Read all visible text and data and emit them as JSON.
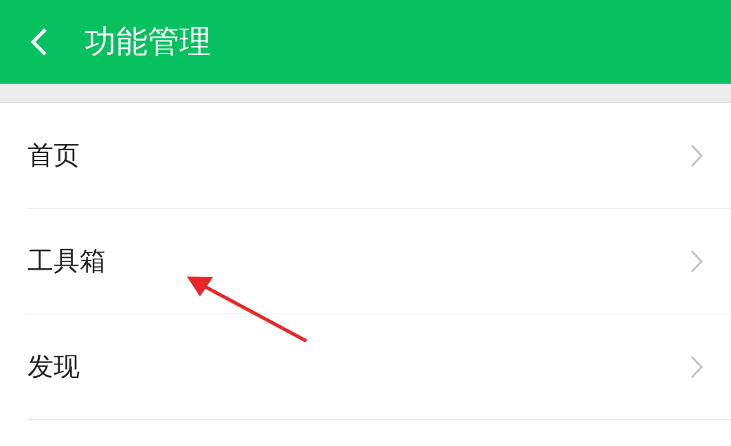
{
  "header": {
    "title": "功能管理"
  },
  "items": [
    {
      "label": "首页"
    },
    {
      "label": "工具箱"
    },
    {
      "label": "发现"
    }
  ]
}
